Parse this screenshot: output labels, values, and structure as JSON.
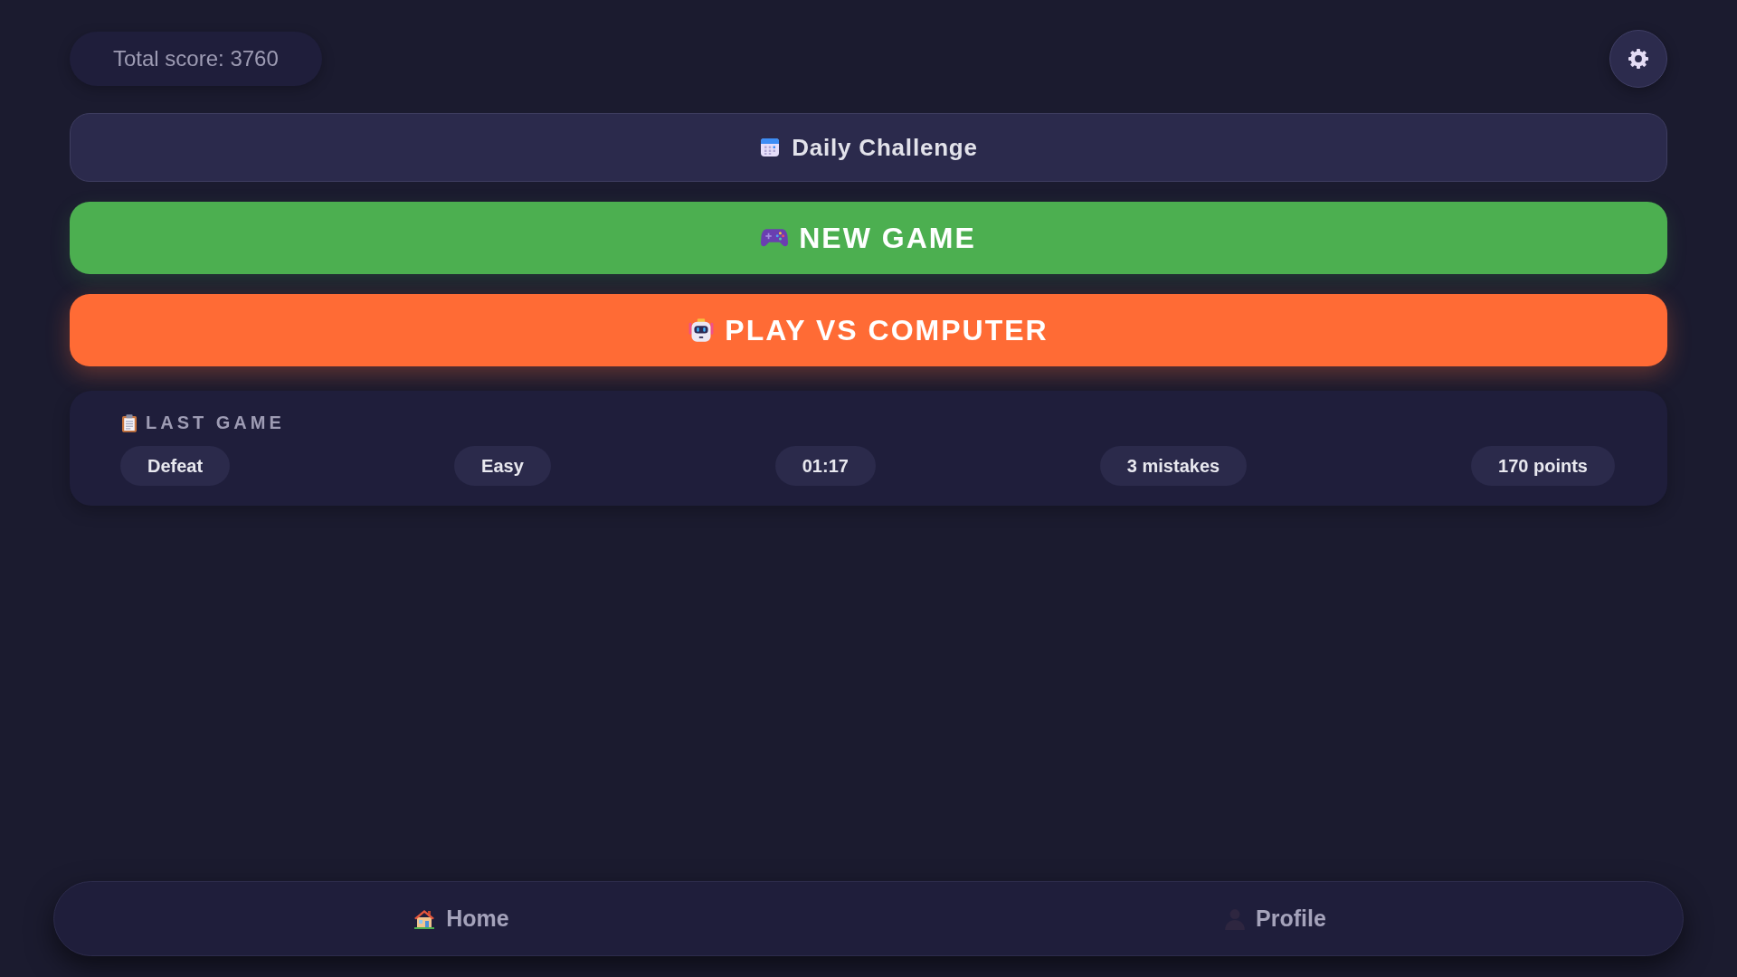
{
  "header": {
    "total_score": "Total score: 3760"
  },
  "actions": [
    {
      "kind": "daily",
      "label": "Daily Challenge"
    },
    {
      "kind": "new_game",
      "label": "NEW GAME"
    },
    {
      "kind": "vs_computer",
      "label": "PLAY VS COMPUTER"
    }
  ],
  "last_game": {
    "title": "LAST GAME",
    "stats": [
      "Defeat",
      "Easy",
      "01:17",
      "3 mistakes",
      "170 points"
    ]
  },
  "nav": [
    {
      "kind": "home",
      "label": "Home",
      "selected": false
    },
    {
      "kind": "profile",
      "label": "Profile",
      "selected": false
    }
  ]
}
